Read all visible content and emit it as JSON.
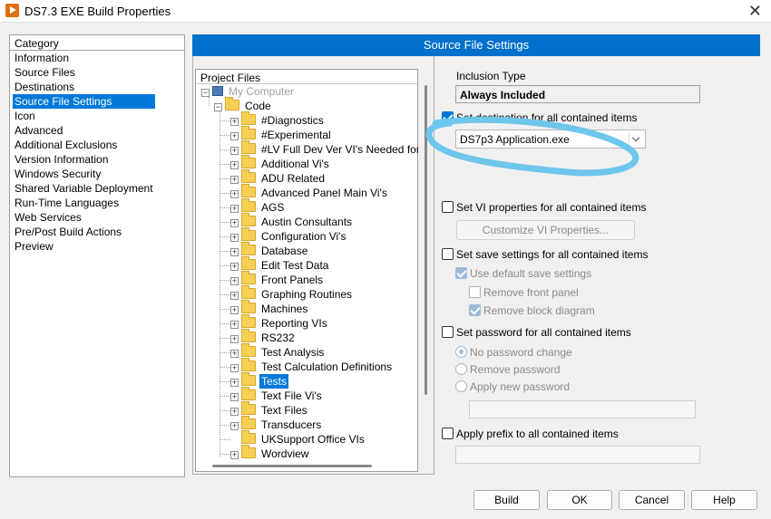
{
  "window": {
    "title": "DS7.3 EXE Build Properties"
  },
  "category": {
    "header": "Category",
    "items": [
      "Information",
      "Source Files",
      "Destinations",
      "Source File Settings",
      "Icon",
      "Advanced",
      "Additional Exclusions",
      "Version Information",
      "Windows Security",
      "Shared Variable Deployment",
      "Run-Time Languages",
      "Web Services",
      "Pre/Post Build Actions",
      "Preview"
    ],
    "selected": "Source File Settings"
  },
  "section_title": "Source File Settings",
  "project_files": {
    "header": "Project Files",
    "root": "My Computer",
    "code": "Code",
    "folders": [
      "#Diagnostics",
      "#Experimental",
      "#LV Full Dev Ver VI's Needed for Dev",
      "Additional Vi's",
      "ADU Related",
      "Advanced Panel Main Vi's",
      "AGS",
      "Austin Consultants",
      "Configuration Vi's",
      "Database",
      "Edit Test Data",
      "Front Panels",
      "Graphing Routines",
      "Machines",
      "Reporting VIs",
      "RS232",
      "Test Analysis",
      "Test Calculation Definitions",
      "Tests",
      "Text File Vi's",
      "Text Files",
      "Transducers",
      "UKSupport Office VIs",
      "Wordview"
    ],
    "selected": "Tests"
  },
  "settings": {
    "inclusion_type_label": "Inclusion Type",
    "inclusion_type_value": "Always Included",
    "set_destination_label": "Set destination for all contained items",
    "destination_value": "DS7p3 Application.exe",
    "set_vi_properties_label": "Set VI properties for all contained items",
    "customize_vi_button": "Customize VI Properties...",
    "set_save_settings_label": "Set save settings for all contained items",
    "use_default_save_label": "Use default save settings",
    "remove_front_panel_label": "Remove front panel",
    "remove_block_diagram_label": "Remove block diagram",
    "set_password_label": "Set password for all contained items",
    "no_password_change_label": "No password change",
    "remove_password_label": "Remove password",
    "apply_new_password_label": "Apply new password",
    "apply_prefix_label": "Apply prefix to all contained items"
  },
  "buttons": {
    "build": "Build",
    "ok": "OK",
    "cancel": "Cancel",
    "help": "Help"
  },
  "colors": {
    "accent": "#0078d7",
    "header": "#0070cc",
    "annotation": "#6ec6ec"
  }
}
